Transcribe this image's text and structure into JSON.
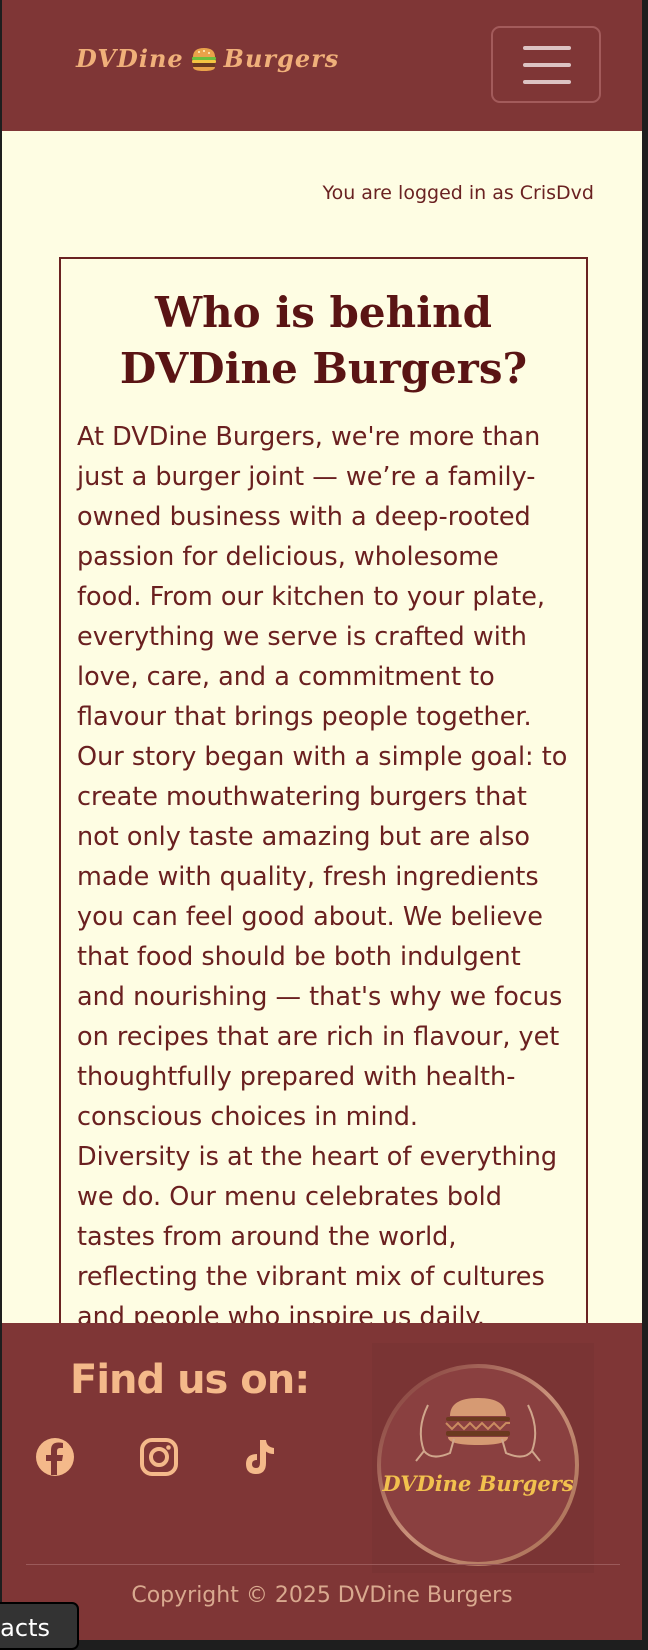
{
  "navbar": {
    "brand_part1": "DVDine",
    "brand_part2": "Burgers",
    "brand_icon": "burger-emoji",
    "toggle_icon": "hamburger-menu-icon"
  },
  "status": {
    "login_text": "You are logged in as CrisDvd"
  },
  "about": {
    "title": "Who is behind DVDine Burgers?",
    "paragraphs": [
      "At DVDine Burgers, we're more than just a burger joint — we’re a family-owned business with a deep-rooted passion for delicious, wholesome food. From our kitchen to your plate, everything we serve is crafted with love, care, and a commitment to flavour that brings people together.",
      "Our story began with a simple goal: to create mouthwatering burgers that not only taste amazing but are also made with quality, fresh ingredients you can feel good about. We believe that food should be both indulgent and nourishing — that's why we focus on recipes that are rich in flavour, yet thoughtfully prepared with health-conscious choices in mind.",
      "Diversity is at the heart of everything we do. Our menu celebrates bold tastes from around the world, reflecting the vibrant mix of cultures and people who inspire us daily."
    ]
  },
  "footer": {
    "find_us_label": "Find us on:",
    "social_icons": [
      "facebook-icon",
      "instagram-icon",
      "tiktok-icon"
    ],
    "logo_text": "DVDine Burgers",
    "copyright": "Copyright © 2025 DVDine Burgers"
  },
  "floating_tab": {
    "label": "acts"
  },
  "colors": {
    "navbar_bg": "#7f3636",
    "page_bg": "#fefde3",
    "brand_accent": "#f0b07a",
    "text_dark": "#6a2020",
    "logo_yellow": "#f2c14e"
  }
}
